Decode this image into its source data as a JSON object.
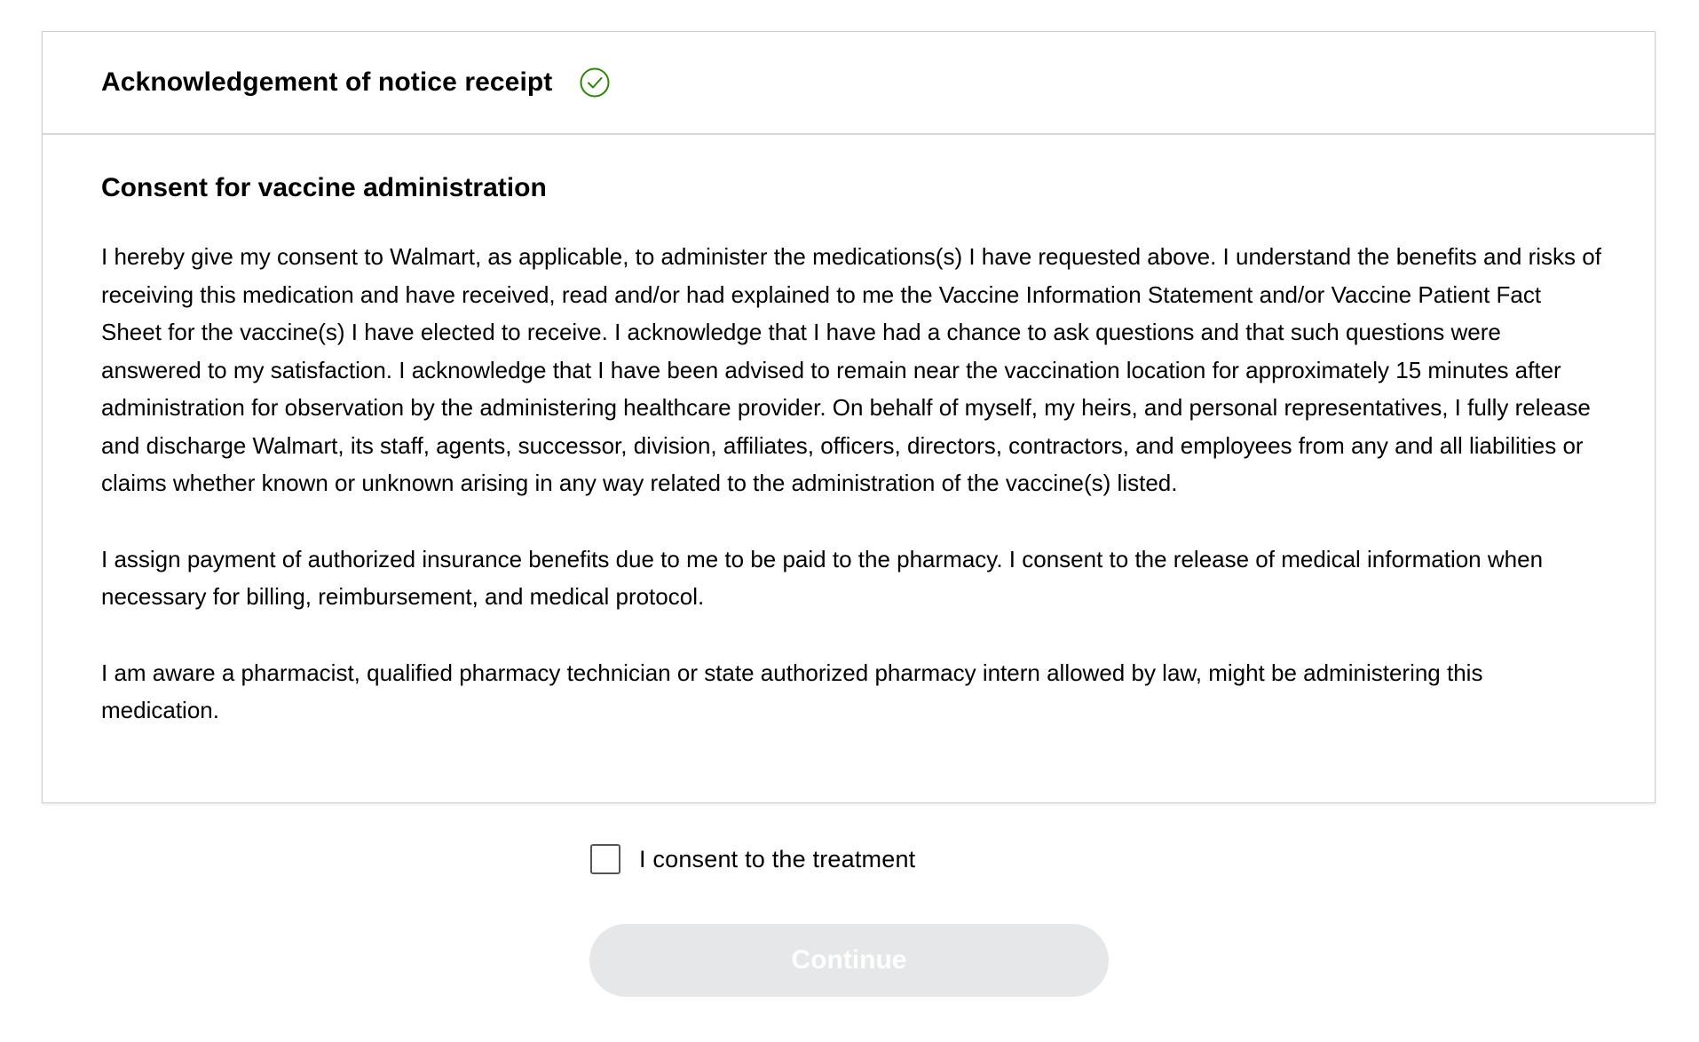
{
  "acknowledgement": {
    "title": "Acknowledgement of notice receipt",
    "status_icon": "check-circle-icon",
    "status_color": "#2a8703"
  },
  "consent": {
    "title": "Consent for vaccine administration",
    "paragraphs": [
      "I hereby give my consent to Walmart, as applicable, to administer the medications(s) I have requested above. I understand the benefits and risks of receiving this medication and have received, read and/or had explained to me the Vaccine Information Statement and/or Vaccine Patient Fact Sheet for the vaccine(s) I have elected to receive. I acknowledge that I have had a chance to ask questions and that such questions were answered to my satisfaction. I acknowledge that I have been advised to remain near the vaccination location for approximately 15 minutes after administration for observation by the administering healthcare provider. On behalf of myself, my heirs, and personal representatives, I fully release and discharge Walmart, its staff, agents, successor, division, affiliates, officers, directors, contractors, and employees from any and all liabilities or claims whether known or unknown arising in any way related to the administration of the vaccine(s) listed.",
      "I assign payment of authorized insurance benefits due to me to be paid to the pharmacy. I consent to the release of medical information when necessary for billing, reimbursement, and medical protocol.",
      "I am aware a pharmacist, qualified pharmacy technician or state authorized pharmacy intern allowed by law, might be administering this medication."
    ]
  },
  "checkbox": {
    "label": "I consent to the treatment",
    "checked": false
  },
  "continue_button": {
    "label": "Continue",
    "disabled": true,
    "background": "#e6e7e8"
  }
}
